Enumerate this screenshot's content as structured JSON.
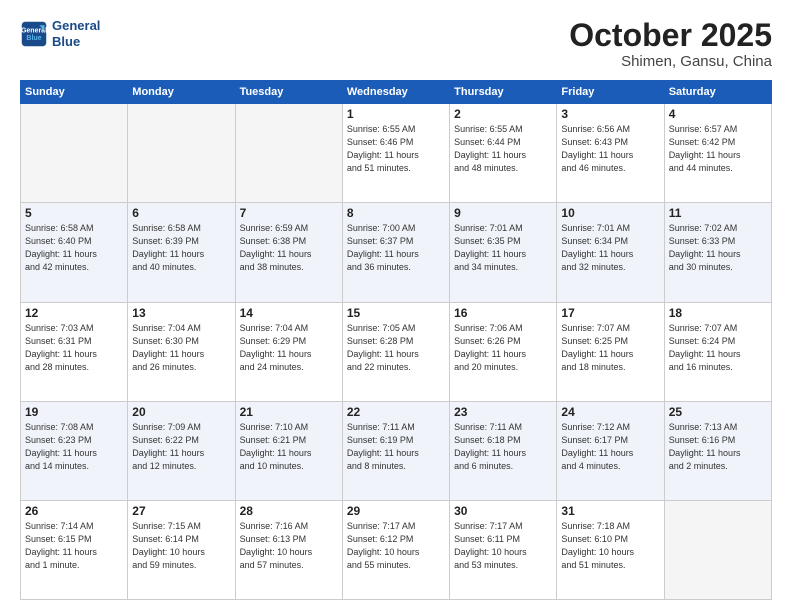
{
  "header": {
    "logo_line1": "General",
    "logo_line2": "Blue",
    "title": "October 2025",
    "location": "Shimen, Gansu, China"
  },
  "weekdays": [
    "Sunday",
    "Monday",
    "Tuesday",
    "Wednesday",
    "Thursday",
    "Friday",
    "Saturday"
  ],
  "weeks": [
    [
      {
        "day": "",
        "info": ""
      },
      {
        "day": "",
        "info": ""
      },
      {
        "day": "",
        "info": ""
      },
      {
        "day": "1",
        "info": "Sunrise: 6:55 AM\nSunset: 6:46 PM\nDaylight: 11 hours\nand 51 minutes."
      },
      {
        "day": "2",
        "info": "Sunrise: 6:55 AM\nSunset: 6:44 PM\nDaylight: 11 hours\nand 48 minutes."
      },
      {
        "day": "3",
        "info": "Sunrise: 6:56 AM\nSunset: 6:43 PM\nDaylight: 11 hours\nand 46 minutes."
      },
      {
        "day": "4",
        "info": "Sunrise: 6:57 AM\nSunset: 6:42 PM\nDaylight: 11 hours\nand 44 minutes."
      }
    ],
    [
      {
        "day": "5",
        "info": "Sunrise: 6:58 AM\nSunset: 6:40 PM\nDaylight: 11 hours\nand 42 minutes."
      },
      {
        "day": "6",
        "info": "Sunrise: 6:58 AM\nSunset: 6:39 PM\nDaylight: 11 hours\nand 40 minutes."
      },
      {
        "day": "7",
        "info": "Sunrise: 6:59 AM\nSunset: 6:38 PM\nDaylight: 11 hours\nand 38 minutes."
      },
      {
        "day": "8",
        "info": "Sunrise: 7:00 AM\nSunset: 6:37 PM\nDaylight: 11 hours\nand 36 minutes."
      },
      {
        "day": "9",
        "info": "Sunrise: 7:01 AM\nSunset: 6:35 PM\nDaylight: 11 hours\nand 34 minutes."
      },
      {
        "day": "10",
        "info": "Sunrise: 7:01 AM\nSunset: 6:34 PM\nDaylight: 11 hours\nand 32 minutes."
      },
      {
        "day": "11",
        "info": "Sunrise: 7:02 AM\nSunset: 6:33 PM\nDaylight: 11 hours\nand 30 minutes."
      }
    ],
    [
      {
        "day": "12",
        "info": "Sunrise: 7:03 AM\nSunset: 6:31 PM\nDaylight: 11 hours\nand 28 minutes."
      },
      {
        "day": "13",
        "info": "Sunrise: 7:04 AM\nSunset: 6:30 PM\nDaylight: 11 hours\nand 26 minutes."
      },
      {
        "day": "14",
        "info": "Sunrise: 7:04 AM\nSunset: 6:29 PM\nDaylight: 11 hours\nand 24 minutes."
      },
      {
        "day": "15",
        "info": "Sunrise: 7:05 AM\nSunset: 6:28 PM\nDaylight: 11 hours\nand 22 minutes."
      },
      {
        "day": "16",
        "info": "Sunrise: 7:06 AM\nSunset: 6:26 PM\nDaylight: 11 hours\nand 20 minutes."
      },
      {
        "day": "17",
        "info": "Sunrise: 7:07 AM\nSunset: 6:25 PM\nDaylight: 11 hours\nand 18 minutes."
      },
      {
        "day": "18",
        "info": "Sunrise: 7:07 AM\nSunset: 6:24 PM\nDaylight: 11 hours\nand 16 minutes."
      }
    ],
    [
      {
        "day": "19",
        "info": "Sunrise: 7:08 AM\nSunset: 6:23 PM\nDaylight: 11 hours\nand 14 minutes."
      },
      {
        "day": "20",
        "info": "Sunrise: 7:09 AM\nSunset: 6:22 PM\nDaylight: 11 hours\nand 12 minutes."
      },
      {
        "day": "21",
        "info": "Sunrise: 7:10 AM\nSunset: 6:21 PM\nDaylight: 11 hours\nand 10 minutes."
      },
      {
        "day": "22",
        "info": "Sunrise: 7:11 AM\nSunset: 6:19 PM\nDaylight: 11 hours\nand 8 minutes."
      },
      {
        "day": "23",
        "info": "Sunrise: 7:11 AM\nSunset: 6:18 PM\nDaylight: 11 hours\nand 6 minutes."
      },
      {
        "day": "24",
        "info": "Sunrise: 7:12 AM\nSunset: 6:17 PM\nDaylight: 11 hours\nand 4 minutes."
      },
      {
        "day": "25",
        "info": "Sunrise: 7:13 AM\nSunset: 6:16 PM\nDaylight: 11 hours\nand 2 minutes."
      }
    ],
    [
      {
        "day": "26",
        "info": "Sunrise: 7:14 AM\nSunset: 6:15 PM\nDaylight: 11 hours\nand 1 minute."
      },
      {
        "day": "27",
        "info": "Sunrise: 7:15 AM\nSunset: 6:14 PM\nDaylight: 10 hours\nand 59 minutes."
      },
      {
        "day": "28",
        "info": "Sunrise: 7:16 AM\nSunset: 6:13 PM\nDaylight: 10 hours\nand 57 minutes."
      },
      {
        "day": "29",
        "info": "Sunrise: 7:17 AM\nSunset: 6:12 PM\nDaylight: 10 hours\nand 55 minutes."
      },
      {
        "day": "30",
        "info": "Sunrise: 7:17 AM\nSunset: 6:11 PM\nDaylight: 10 hours\nand 53 minutes."
      },
      {
        "day": "31",
        "info": "Sunrise: 7:18 AM\nSunset: 6:10 PM\nDaylight: 10 hours\nand 51 minutes."
      },
      {
        "day": "",
        "info": ""
      }
    ]
  ]
}
